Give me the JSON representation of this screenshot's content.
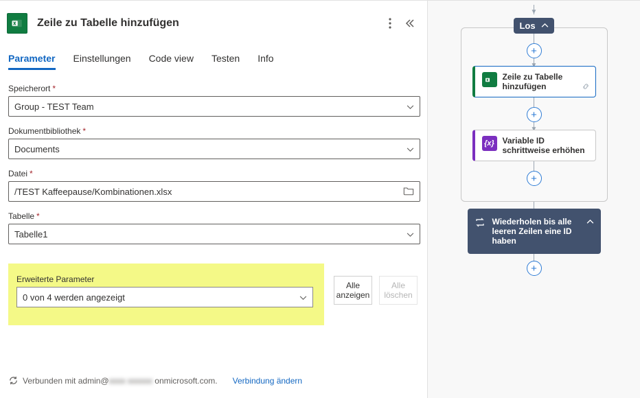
{
  "header": {
    "title": "Zeile zu Tabelle hinzufügen"
  },
  "tabs": {
    "parameter": "Parameter",
    "settings": "Einstellungen",
    "codeview": "Code view",
    "test": "Testen",
    "info": "Info"
  },
  "fields": {
    "location_label": "Speicherort",
    "location_value": "Group - TEST Team",
    "library_label": "Dokumentbibliothek",
    "library_value": "Documents",
    "file_label": "Datei",
    "file_value": "/TEST Kaffeepause/Kombinationen.xlsx",
    "table_label": "Tabelle",
    "table_value": "Tabelle1"
  },
  "advanced": {
    "label": "Erweiterte Parameter",
    "value": "0 von 4 werden angezeigt",
    "show_all": "Alle anzeigen",
    "clear_all": "Alle löschen"
  },
  "footer": {
    "prefix": "Verbunden mit admin@",
    "blurred": "xxxx xxxxxx",
    "suffix": "onmicrosoft.com.",
    "change": "Verbindung ändern"
  },
  "flow": {
    "loop_label": "Los",
    "card1": "Zeile zu Tabelle hinzufügen",
    "card2": "Variable ID schrittweise erhöhen",
    "repeat": "Wiederholen bis alle leeren Zeilen eine ID haben"
  }
}
